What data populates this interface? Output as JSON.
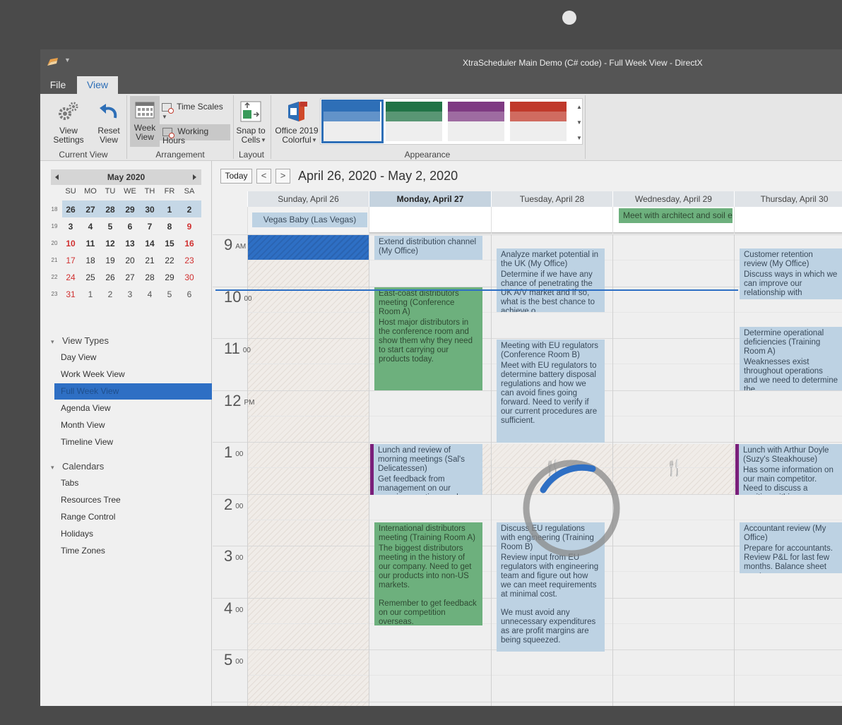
{
  "window": {
    "title": "XtraScheduler Main Demo (C# code) - Full Week View - DirectX"
  },
  "menu_tabs": [
    {
      "label": "File"
    },
    {
      "label": "View"
    }
  ],
  "ribbon": {
    "view_settings": "View Settings",
    "reset_view": "Reset View",
    "current_view_group": "Current View",
    "week_view": "Week View",
    "time_scales": "Time Scales",
    "working_hours": "Working Hours",
    "arrangement_group": "Arrangement",
    "snap_to_cells": "Snap to Cells",
    "layout_group": "Layout",
    "office_theme": "Office 2019 Colorful",
    "appearance_group": "Appearance",
    "swatches": [
      "#2e6fb7",
      "#217346",
      "#7e3a82",
      "#c0392b"
    ]
  },
  "mini_calendar": {
    "month": "May 2020",
    "dow": [
      "SU",
      "MO",
      "TU",
      "WE",
      "TH",
      "FR",
      "SA"
    ],
    "weeks": [
      {
        "num": "18",
        "days": [
          "26",
          "27",
          "28",
          "29",
          "30",
          "1",
          "2"
        ]
      },
      {
        "num": "19",
        "days": [
          "3",
          "4",
          "5",
          "6",
          "7",
          "8",
          "9"
        ]
      },
      {
        "num": "20",
        "days": [
          "10",
          "11",
          "12",
          "13",
          "14",
          "15",
          "16"
        ]
      },
      {
        "num": "21",
        "days": [
          "17",
          "18",
          "19",
          "20",
          "21",
          "22",
          "23"
        ]
      },
      {
        "num": "22",
        "days": [
          "24",
          "25",
          "26",
          "27",
          "28",
          "29",
          "30"
        ]
      },
      {
        "num": "23",
        "days": [
          "31",
          "1",
          "2",
          "3",
          "4",
          "5",
          "6"
        ]
      }
    ]
  },
  "nav": {
    "view_types_header": "View Types",
    "view_types": [
      "Day View",
      "Work Week View",
      "Full Week View",
      "Agenda View",
      "Month View",
      "Timeline View"
    ],
    "calendars_header": "Calendars",
    "calendars": [
      "Tabs",
      "Resources Tree",
      "Range Control",
      "Holidays",
      "Time Zones"
    ]
  },
  "scheduler": {
    "today": "Today",
    "prev": "<",
    "next": ">",
    "range": "April 26, 2020 - May 2, 2020",
    "columns": [
      "Sunday, April 26",
      "Monday, April 27",
      "Tuesday, April 28",
      "Wednesday, April 29",
      "Thursday, April 30"
    ],
    "allday": [
      "Vegas Baby (Las Vegas)",
      "Meet with architect and soil e..."
    ],
    "hours": [
      {
        "h": "9",
        "s": "AM"
      },
      {
        "h": "10",
        "s": "00"
      },
      {
        "h": "11",
        "s": "00"
      },
      {
        "h": "12",
        "s": "PM"
      },
      {
        "h": "1",
        "s": "00"
      },
      {
        "h": "2",
        "s": "00"
      },
      {
        "h": "3",
        "s": "00"
      },
      {
        "h": "4",
        "s": "00"
      },
      {
        "h": "5",
        "s": "00"
      }
    ],
    "appointments": [
      {
        "title": "Extend distribution channel (My Office)",
        "desc": ""
      },
      {
        "title": "East-coast distributors meeting (Conference Room A)",
        "desc": "Host major distributors in the conference room and show them why they need to start carrying our products today."
      },
      {
        "title": "Lunch and review of morning meetings (Sal's Delicatessen)",
        "desc": "Get feedback from management on our morning meetings and see if there's"
      },
      {
        "title": "International distributors meeting (Training Room A)",
        "desc": "The biggest distributors meeting in the history of our company. Need to get our products into non-US markets.",
        "desc2": "Remember to get feedback on our competition overseas."
      },
      {
        "title": "Analyze market potential in the UK (My Office)",
        "desc": "Determine if we have any chance of penetrating the UK A/V market and if so, what is the best chance to achieve o"
      },
      {
        "title": "Meeting with EU regulators (Conference Room B)",
        "desc": "Meet with EU regulators to determine battery disposal regulations and how we can avoid fines going forward. Need to verify if our current procedures are sufficient."
      },
      {
        "title": "Discuss EU regulations with engineering (Training Room B)",
        "desc": "Review input from EU regulators with engineering team and figure out how we can meet requirements at minimal cost.",
        "desc2": "We must avoid any unnecessary expenditures as are profit margins are being squeezed."
      },
      {
        "title": "Customer retention review (My Office)",
        "desc": "Discuss ways in which we can improve our relationship with"
      },
      {
        "title": "Determine operational deficiencies (Training Room A)",
        "desc": "Weaknesses exist throughout operations and we need to determine the"
      },
      {
        "title": "Lunch with Arthur Doyle (Suzy's Steakhouse)",
        "desc": "Has some information on our main competitor. Need to discuss a position within our"
      },
      {
        "title": "Accountant review (My Office)",
        "desc": "Prepare for accountants. Review P&L for last few months. Balance sheet must"
      }
    ],
    "colors": {
      "selection": "#2e6fc4",
      "appt_blue": "#bdd2e3",
      "appt_green": "#6db07d",
      "lunch_bar": "#7a1f7a"
    }
  }
}
